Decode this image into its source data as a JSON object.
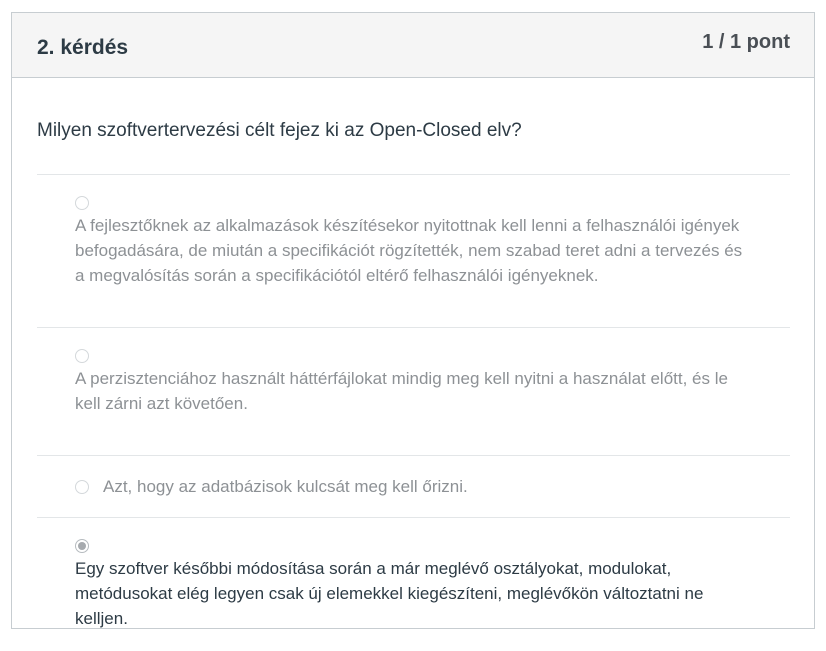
{
  "question": {
    "title": "2. kérdés",
    "points": "1 / 1 pont",
    "text": "Milyen szoftvertervezési célt fejez ki az Open-Closed elv?"
  },
  "answers": [
    {
      "text": "A fejlesztőknek az alkalmazások készítésekor nyitottnak kell lenni a felhasználói igények befogadására, de miután a specifikációt rögzítették, nem szabad teret adni a tervezés és a megvalósítás során a specifikációtól eltérő felhasználói igényeknek.",
      "selected": false
    },
    {
      "text": "A perzisztenciához használt háttérfájlokat mindig meg kell nyitni a használat előtt, és le kell zárni azt követően.",
      "selected": false
    },
    {
      "text": "Azt, hogy az adatbázisok kulcsát meg kell őrizni.",
      "selected": false
    },
    {
      "text": "Egy szoftver későbbi módosítása során a már meglévő osztályokat, modulokat, metódusokat elég legyen csak új elemekkel kiegészíteni, meglévőkön változtatni ne kelljen.",
      "selected": true
    }
  ]
}
